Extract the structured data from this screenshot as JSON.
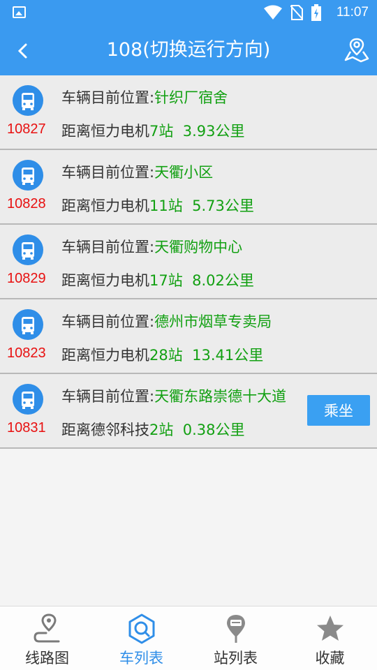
{
  "status_bar": {
    "time": "11:07"
  },
  "header": {
    "title": "108(切换运行方向)"
  },
  "vehicles": [
    {
      "plate": "10827",
      "position_label": "车辆目前位置:",
      "position": "针织厂宿舍",
      "distance_prefix": "距离恒力电机",
      "stops": "7站",
      "distance": "3.93公里"
    },
    {
      "plate": "10828",
      "position_label": "车辆目前位置:",
      "position": "天衢小区",
      "distance_prefix": "距离恒力电机",
      "stops": "11站",
      "distance": "5.73公里"
    },
    {
      "plate": "10829",
      "position_label": "车辆目前位置:",
      "position": "天衢购物中心",
      "distance_prefix": "距离恒力电机",
      "stops": "17站",
      "distance": "8.02公里"
    },
    {
      "plate": "10823",
      "position_label": "车辆目前位置:",
      "position": "德州市烟草专卖局",
      "distance_prefix": "距离恒力电机",
      "stops": "28站",
      "distance": "13.41公里"
    },
    {
      "plate": "10831",
      "position_label": "车辆目前位置:",
      "position": "天衢东路崇德十大道",
      "distance_prefix": "距离德邻科技",
      "stops": "2站",
      "distance": "0.38公里",
      "action": "乘坐"
    }
  ],
  "tabs": [
    {
      "label": "线路图",
      "icon": "route-map-icon"
    },
    {
      "label": "车列表",
      "icon": "bus-search-icon",
      "active": true
    },
    {
      "label": "站列表",
      "icon": "stop-pin-icon"
    },
    {
      "label": "收藏",
      "icon": "star-icon"
    }
  ],
  "colors": {
    "primary": "#3a9af0",
    "plate": "#e81010",
    "highlight": "#12a012"
  }
}
